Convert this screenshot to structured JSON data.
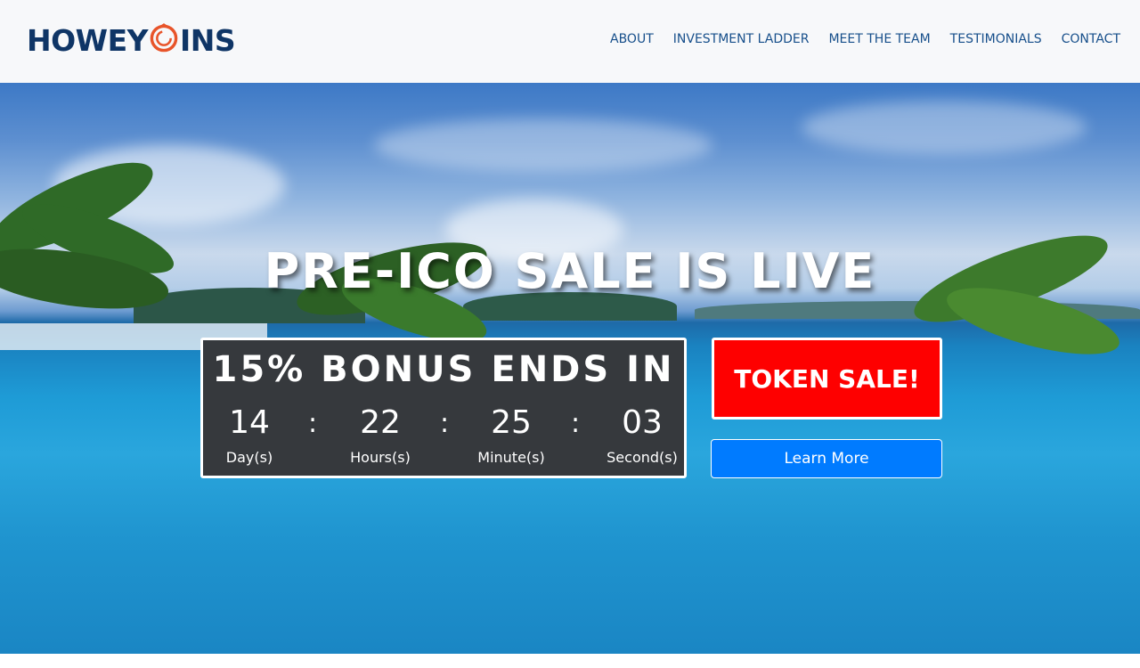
{
  "brand": {
    "logo_prefix": "HOWEY",
    "logo_suffix": "INS",
    "primary_color": "#0f3566",
    "accent_color": "#e8542a"
  },
  "nav": {
    "items": [
      {
        "label": "ABOUT"
      },
      {
        "label": "INVESTMENT LADDER"
      },
      {
        "label": "MEET THE TEAM"
      },
      {
        "label": "TESTIMONIALS"
      },
      {
        "label": "CONTACT"
      }
    ]
  },
  "hero": {
    "title": "PRE-ICO SALE IS LIVE"
  },
  "countdown": {
    "title": "15% BONUS ENDS IN",
    "separator": ":",
    "units": [
      {
        "value": "14",
        "label": "Day(s)"
      },
      {
        "value": "22",
        "label": "Hours(s)"
      },
      {
        "value": "25",
        "label": "Minute(s)"
      },
      {
        "value": "03",
        "label": "Second(s)"
      }
    ]
  },
  "cta": {
    "token_sale_label": "TOKEN SALE!",
    "learn_more_label": "Learn More",
    "token_sale_color": "#fe0000",
    "learn_more_color": "#007bff"
  }
}
